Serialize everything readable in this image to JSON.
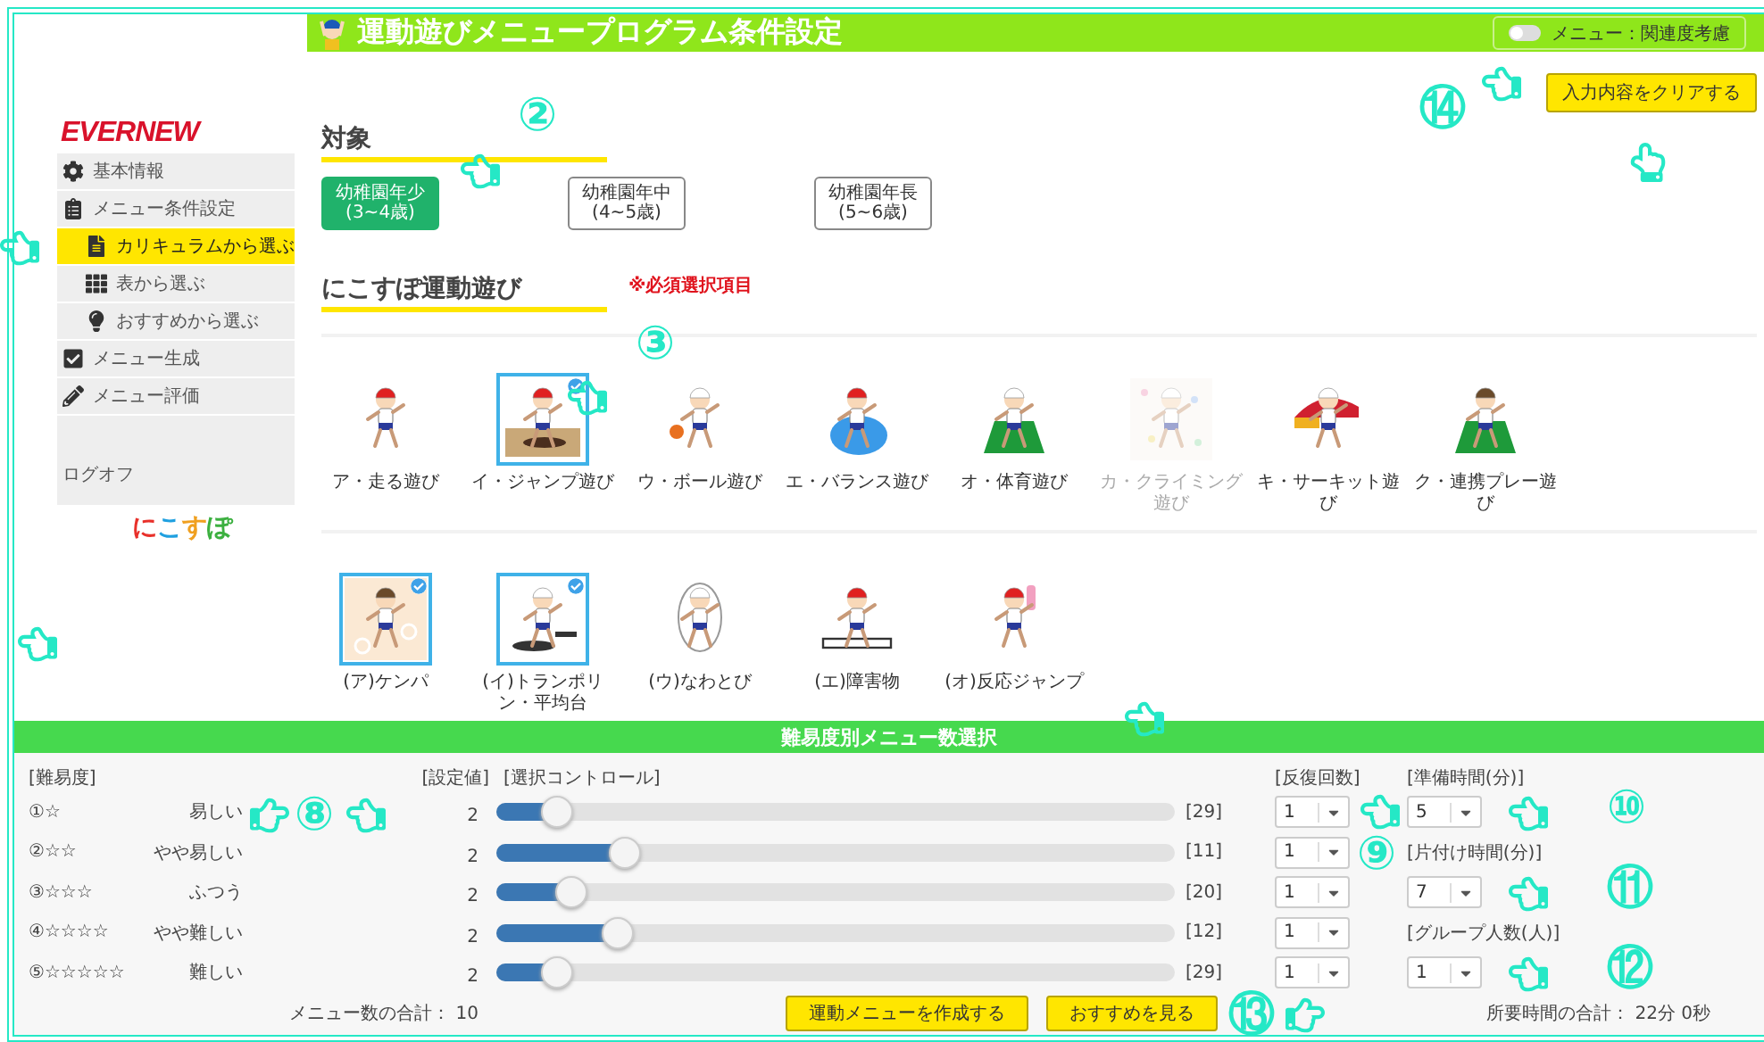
{
  "header": {
    "title": "運動遊びメニュープログラム条件設定",
    "toggle": {
      "label": "メニュー：関連度考慮",
      "on": false
    }
  },
  "clear_button": "入力内容をクリアする",
  "sidebar": {
    "logo": "EVERNEW",
    "items": [
      {
        "label": "基本情報",
        "kind": "gear",
        "selected": false
      },
      {
        "label": "メニュー条件設定",
        "kind": "clipboard",
        "selected": false,
        "children": [
          {
            "label": "カリキュラムから選ぶ",
            "kind": "file",
            "selected": true
          },
          {
            "label": "表から選ぶ",
            "kind": "grid",
            "selected": false
          },
          {
            "label": "おすすめから選ぶ",
            "kind": "bulb",
            "selected": false
          }
        ]
      },
      {
        "label": "メニュー生成",
        "kind": "check",
        "selected": false
      },
      {
        "label": "メニュー評価",
        "kind": "pencil",
        "selected": false
      }
    ],
    "logoff": "ログオフ",
    "brand": "にこすぽ"
  },
  "target": {
    "title": "対象",
    "options": [
      {
        "label": "幼稚園年少",
        "sub": "(3~4歳)",
        "selected": true
      },
      {
        "label": "幼稚園年中",
        "sub": "(4~5歳)",
        "selected": false
      },
      {
        "label": "幼稚園年長",
        "sub": "(5~6歳)",
        "selected": false
      }
    ]
  },
  "activities": {
    "title": "にこすぽ運動遊び",
    "note": "※必須選択項目",
    "items": [
      {
        "label": "ア・走る遊び",
        "selected": false,
        "disabled": false
      },
      {
        "label": "イ・ジャンプ遊び",
        "selected": true,
        "disabled": false
      },
      {
        "label": "ウ・ボール遊び",
        "selected": false,
        "disabled": false
      },
      {
        "label": "エ・バランス遊び",
        "selected": false,
        "disabled": false
      },
      {
        "label": "オ・体育遊び",
        "selected": false,
        "disabled": false
      },
      {
        "label": "カ・クライミング遊び",
        "selected": false,
        "disabled": true
      },
      {
        "label": "キ・サーキット遊び",
        "selected": false,
        "disabled": false
      },
      {
        "label": "ク・連携プレー遊び",
        "selected": false,
        "disabled": false
      }
    ],
    "sub_items": [
      {
        "label": "(ア)ケンパ",
        "selected": true
      },
      {
        "label": "(イ)トランポリン・平均台",
        "selected": true
      },
      {
        "label": "(ウ)なわとび",
        "selected": false
      },
      {
        "label": "(エ)障害物",
        "selected": false
      },
      {
        "label": "(オ)反応ジャンプ",
        "selected": false
      }
    ]
  },
  "difficulty": {
    "title": "難易度別メニュー数選択",
    "headers": {
      "level": "[難易度]",
      "value": "[設定値]",
      "control": "[選択コントロール]",
      "repeat": "[反復回数]"
    },
    "rows": [
      {
        "rank": "①☆",
        "label": "易しい",
        "value": "2",
        "level": 0.09,
        "max": "[29]",
        "repeat": "1"
      },
      {
        "rank": "②☆☆",
        "label": "やや易しい",
        "value": "2",
        "level": 0.19,
        "max": "[11]",
        "repeat": "1"
      },
      {
        "rank": "③☆☆☆",
        "label": "ふつう",
        "value": "2",
        "level": 0.11,
        "max": "[20]",
        "repeat": "1"
      },
      {
        "rank": "④☆☆☆☆",
        "label": "やや難しい",
        "value": "2",
        "level": 0.18,
        "max": "[12]",
        "repeat": "1"
      },
      {
        "rank": "⑤☆☆☆☆☆",
        "label": "難しい",
        "value": "2",
        "level": 0.09,
        "max": "[29]",
        "repeat": "1"
      }
    ],
    "side_fields": [
      {
        "label": "[準備時間(分)]",
        "value": "5"
      },
      {
        "label": "[片付け時間(分)]",
        "value": "7"
      },
      {
        "label": "[グループ人数(人)]",
        "value": "1"
      }
    ],
    "menu_total": "メニュー数の合計： 10",
    "buttons": [
      "運動メニューを作成する",
      "おすすめを見る"
    ],
    "time_total": "所要時間の合計： 22分 0秒"
  },
  "annotations": [
    "②",
    "③",
    "⑭",
    "⑧",
    "⑨",
    "⑩",
    "⑪",
    "⑫",
    "⑬"
  ]
}
